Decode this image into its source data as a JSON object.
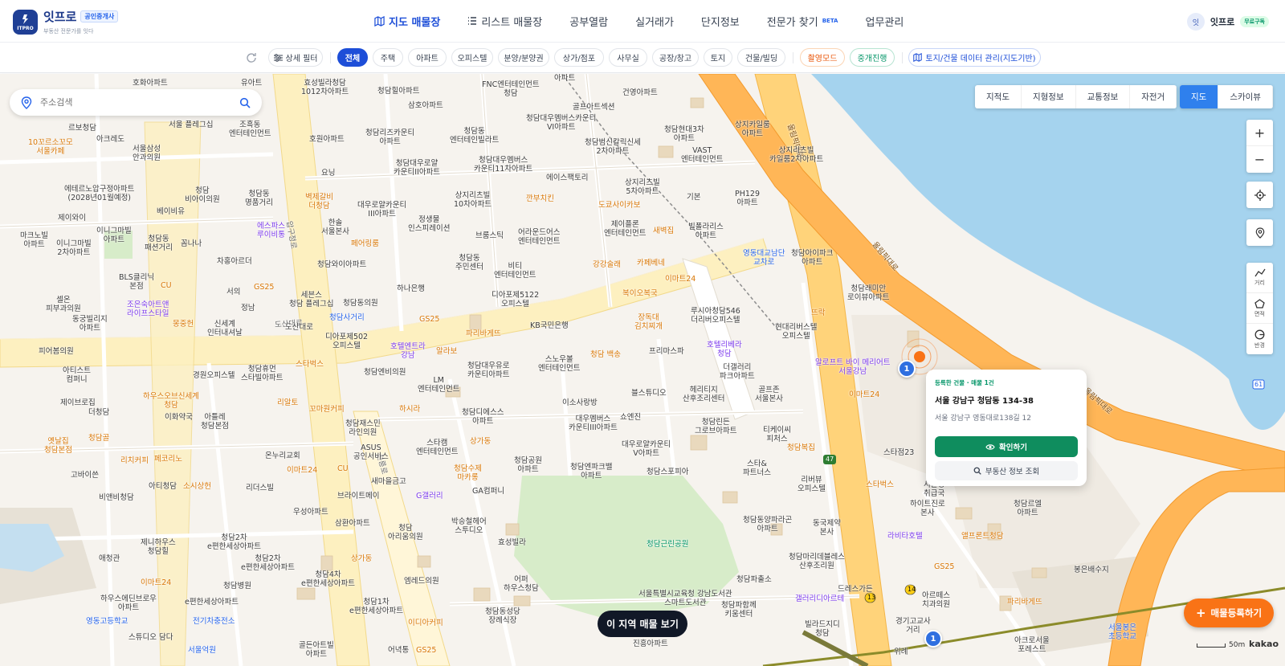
{
  "brand": {
    "name": "잇프로",
    "badge": "공인중개사",
    "subtitle": "부동산 전문가를 잇다",
    "logo_text": "ITPRO"
  },
  "nav": {
    "items": [
      {
        "label": "지도 매물장",
        "icon": "map-icon",
        "active": true
      },
      {
        "label": "리스트 매물장",
        "icon": "list-icon",
        "active": false
      },
      {
        "label": "공부열람",
        "active": false
      },
      {
        "label": "실거래가",
        "active": false
      },
      {
        "label": "단지정보",
        "active": false
      },
      {
        "label": "전문가 찾기",
        "badge": "BETA",
        "active": false
      },
      {
        "label": "업무관리",
        "active": false
      }
    ]
  },
  "user": {
    "avatar": "잇",
    "name": "잇프로",
    "plan": "무료구독"
  },
  "filters": {
    "detail": "상세 필터",
    "chips": [
      "전체",
      "주택",
      "아파트",
      "오피스텔",
      "분양/분양권",
      "상가/점포",
      "사무실",
      "공장/창고",
      "토지",
      "건물/빌딩"
    ],
    "mode": "촬영모드",
    "brokerage": "중개진행",
    "land": "토지/건물 데이터 관리(지도기반)"
  },
  "search": {
    "placeholder": "주소검색"
  },
  "map_types": [
    "지적도",
    "지형정보",
    "교통정보",
    "자전거"
  ],
  "view_types": [
    "지도",
    "스카이뷰"
  ],
  "controls": {
    "zoom_in": "+",
    "zoom_out": "−",
    "distance": "거리",
    "area": "면적",
    "radius": "반경"
  },
  "popup": {
    "tag": "등록한 건물 · 매물 1건",
    "title": "서울 강남구 청담동 134-38",
    "address": "서울 강남구 영동대로138길 12",
    "confirm": "확인하기",
    "lookup": "부동산 정보 조회"
  },
  "clusters": [
    "1",
    "1"
  ],
  "view_area_button": "이 지역 매물 보기",
  "register_button": "매물등록하기",
  "scale": "50m",
  "attribution": "kakao",
  "roads": {
    "olympic": "올림픽대로",
    "dosandaero": "도산대로",
    "apgujeong": "압구정로",
    "seonreung": "선릉로",
    "route13": "13",
    "route14": "14",
    "route47": "47",
    "route61": "61"
  },
  "pois": [
    [
      "유아트",
      300,
      6,
      ""
    ],
    [
      "효성빌라청담\n1012차아파트",
      375,
      6,
      ""
    ],
    [
      "청담힐아파트",
      470,
      16,
      ""
    ],
    [
      "FNC엔터테인먼트\n청담",
      600,
      8,
      ""
    ],
    [
      "아파트",
      690,
      0,
      ""
    ],
    [
      "건영아파트",
      775,
      18,
      ""
    ],
    [
      "호화아파트",
      165,
      6,
      ""
    ],
    [
      "삼호아파트",
      508,
      34,
      ""
    ],
    [
      "골프아트섹션",
      713,
      36,
      ""
    ],
    [
      "청담대우멤버스카운티\nVI아파트",
      655,
      50,
      ""
    ],
    [
      "청담현대3차\n아파트",
      827,
      64,
      ""
    ],
    [
      "상지카일룸\n아파트",
      915,
      58,
      ""
    ],
    [
      "르보청담",
      85,
      62,
      ""
    ],
    [
      "아크레도",
      120,
      76,
      ""
    ],
    [
      "서울 플레그십",
      210,
      58,
      ""
    ],
    [
      "조흑동\n엔터테인먼트",
      285,
      58,
      ""
    ],
    [
      "청담리즈카운티\n아파트",
      455,
      68,
      ""
    ],
    [
      "청담동\n엔터테인빌라트",
      560,
      66,
      ""
    ],
    [
      "청담범신칼릭신세\n2차아파트",
      728,
      80,
      ""
    ],
    [
      "10꼬르소꼬모\n서울카페",
      35,
      80,
      "o"
    ],
    [
      "서울삼성\n안과의원",
      165,
      88,
      ""
    ],
    [
      "호원아파트",
      385,
      76,
      ""
    ],
    [
      "VAST\n엔터테인먼트",
      848,
      90,
      ""
    ],
    [
      "상지리츠빌\n카일룸2차아파트",
      958,
      90,
      ""
    ],
    [
      "청담대우로얄\n카운티II아파트",
      490,
      106,
      ""
    ],
    [
      "청담대우멤버스\n카운티11차아파트",
      590,
      102,
      ""
    ],
    [
      "에이스팩토리",
      680,
      124,
      ""
    ],
    [
      "상지리츠빌\n5차아파트",
      778,
      130,
      ""
    ],
    [
      "에테르노압구정아파트\n(2028년01월예정)",
      80,
      138,
      ""
    ],
    [
      "청담\n비아이의원",
      230,
      140,
      ""
    ],
    [
      "요닝",
      400,
      118,
      ""
    ],
    [
      "청담동\n명품거리",
      305,
      144,
      ""
    ],
    [
      "상지리츠빌\n10차아파트",
      565,
      146,
      ""
    ],
    [
      "기본",
      855,
      148,
      ""
    ],
    [
      "PH129\n아파트",
      915,
      144,
      ""
    ],
    [
      "벽제갈비\n더청담",
      380,
      148,
      "o"
    ],
    [
      "대우로얄카운티\nIII아파트",
      445,
      158,
      ""
    ],
    [
      "깐부치킨",
      655,
      150,
      "o"
    ],
    [
      "도쿄사이카보",
      745,
      158,
      "o"
    ],
    [
      "베이비유",
      195,
      166,
      ""
    ],
    [
      "제이와이",
      72,
      174,
      ""
    ],
    [
      "에스파스\n루이비통",
      320,
      184,
      "p"
    ],
    [
      "한솔\n서울본사",
      400,
      180,
      ""
    ],
    [
      "정생물\n인스피레이션",
      508,
      176,
      ""
    ],
    [
      "제이플론\n엔터테인먼트",
      752,
      182,
      ""
    ],
    [
      "새벽집",
      813,
      190,
      "o"
    ],
    [
      "빌폴라리스\n아파트",
      857,
      185,
      ""
    ],
    [
      "마크노빌\n아파트",
      25,
      196,
      ""
    ],
    [
      "이니그마빌\n아파트",
      120,
      190,
      ""
    ],
    [
      "청담동\n패션거리",
      180,
      200,
      ""
    ],
    [
      "브룸스틱",
      592,
      196,
      ""
    ],
    [
      "어라운드어스\n엔터테인먼트",
      645,
      192,
      ""
    ],
    [
      "꼼나나",
      225,
      206,
      ""
    ],
    [
      "페어링룸",
      437,
      206,
      "o"
    ],
    [
      "이니그마빌\n2차아파트",
      70,
      206,
      ""
    ],
    [
      "청담와이아파트",
      395,
      232,
      ""
    ],
    [
      "차홍아르더",
      270,
      228,
      ""
    ],
    [
      "청담동\n주민센터",
      567,
      224,
      ""
    ],
    [
      "비티\n엔터테인먼트",
      615,
      234,
      ""
    ],
    [
      "강강술래",
      738,
      232,
      "o"
    ],
    [
      "카페베네",
      793,
      230,
      "o"
    ],
    [
      "영동대교남단\n교차로",
      925,
      218,
      "b"
    ],
    [
      "청담아이파크\n아파트",
      985,
      218,
      ""
    ],
    [
      "BLS클리닉\n본점",
      148,
      248,
      ""
    ],
    [
      "CU",
      200,
      258,
      "o"
    ],
    [
      "GS25",
      316,
      260,
      "o"
    ],
    [
      "세븐스\n청담 플레그십",
      360,
      270,
      ""
    ],
    [
      "서의",
      282,
      266,
      ""
    ],
    [
      "하나은행",
      494,
      262,
      ""
    ],
    [
      "이마트24",
      828,
      250,
      "o"
    ],
    [
      "청담래미안\n로이뷰아파트",
      1055,
      262,
      ""
    ],
    [
      "셀온\n피부과의원",
      57,
      276,
      ""
    ],
    [
      "조은숙아트앤\n라이프스타일",
      158,
      282,
      "p"
    ],
    [
      "정남",
      300,
      286,
      ""
    ],
    [
      "청담동의원",
      427,
      280,
      ""
    ],
    [
      "디아포제5122\n오피스텔",
      612,
      270,
      ""
    ],
    [
      "복이오복국",
      775,
      268,
      "o"
    ],
    [
      "뜨락",
      1010,
      292,
      "o"
    ],
    [
      "동궁빌리지\n아파트",
      90,
      300,
      ""
    ],
    [
      "청담사거리",
      410,
      298,
      "b"
    ],
    [
      "신세계\n인터내셔날",
      258,
      306,
      ""
    ],
    [
      "몽중헌",
      215,
      306,
      "o"
    ],
    [
      "루시아청담546\n더리버오피스텔",
      860,
      290,
      ""
    ],
    [
      "현대리버스텔\n오피스텔",
      965,
      310,
      ""
    ],
    [
      "도산대로",
      355,
      310,
      ""
    ],
    [
      "GS25",
      522,
      300,
      "o"
    ],
    [
      "KB국민은행",
      660,
      308,
      ""
    ],
    [
      "장독대\n김치찌개",
      790,
      298,
      "o"
    ],
    [
      "디아포제502\n오피스텔",
      405,
      322,
      ""
    ],
    [
      "파리바게뜨",
      580,
      318,
      "o"
    ],
    [
      "프리마스파",
      808,
      340,
      ""
    ],
    [
      "호텔리베라\n청담",
      880,
      332,
      "p"
    ],
    [
      "피어봄의원",
      48,
      340,
      ""
    ],
    [
      "호텔엔트라\n강남",
      486,
      334,
      "p"
    ],
    [
      "청담대우유로\n카운티아파트",
      582,
      358,
      ""
    ],
    [
      "스노우볼\n엔터테인먼트",
      670,
      350,
      ""
    ],
    [
      "청담 백송",
      735,
      344,
      "o"
    ],
    [
      "알로프트 바이 메리어트\n서울강남",
      1015,
      354,
      "p"
    ],
    [
      "아티스트\n컴퍼니",
      78,
      364,
      ""
    ],
    [
      "알라보",
      543,
      340,
      "o"
    ],
    [
      "스타벅스",
      368,
      356,
      "o"
    ],
    [
      "청담휴먼\n스타빌아파트",
      300,
      362,
      ""
    ],
    [
      "경원오피스텔",
      240,
      370,
      ""
    ],
    [
      "청담엔비의원",
      453,
      366,
      ""
    ],
    [
      "LM\n엔터테인먼트",
      520,
      376,
      ""
    ],
    [
      "더갤러리\n파크아파트",
      896,
      360,
      ""
    ],
    [
      "하우스오브신세계\n청담",
      178,
      396,
      "o"
    ],
    [
      "헤리티지\n산후조리센터",
      850,
      388,
      ""
    ],
    [
      "골프존\n서울본사",
      940,
      388,
      ""
    ],
    [
      "이마트24",
      1057,
      394,
      "o"
    ],
    [
      "블스튜디오",
      786,
      392,
      ""
    ],
    [
      "제이브로집",
      75,
      404,
      ""
    ],
    [
      "이화약국",
      205,
      422,
      ""
    ],
    [
      "리알토",
      345,
      404,
      "o"
    ],
    [
      "꼬마원커피",
      385,
      412,
      "o"
    ],
    [
      "하시라",
      497,
      412,
      "o"
    ],
    [
      "청담디에스스\n아파트",
      575,
      416,
      ""
    ],
    [
      "이소사랑방",
      700,
      404,
      ""
    ],
    [
      "더청담",
      110,
      416,
      ""
    ],
    [
      "아틀레\n청담본점",
      250,
      422,
      ""
    ],
    [
      "청담재스민\n라인의원",
      430,
      430,
      ""
    ],
    [
      "대우멤버스\n카운티III아파트",
      708,
      424,
      ""
    ],
    [
      "쇼엔진",
      772,
      422,
      ""
    ],
    [
      "청담린든\n그로브아파트",
      865,
      428,
      ""
    ],
    [
      "티케이씨\n피처스",
      950,
      438,
      ""
    ],
    [
      "옛날집\n청담본점",
      55,
      452,
      "o"
    ],
    [
      "청담골",
      110,
      448,
      "o"
    ],
    [
      "스타캠\n엔터테인먼트",
      518,
      454,
      ""
    ],
    [
      "상가동",
      585,
      452,
      "o"
    ],
    [
      "대우로얄카운티\nV아파트",
      774,
      456,
      ""
    ],
    [
      "청담복집",
      980,
      460,
      "o"
    ],
    [
      "리치커피",
      150,
      476,
      "o"
    ],
    [
      "페코리노",
      192,
      474,
      "o"
    ],
    [
      "온누리교회",
      330,
      470,
      ""
    ],
    [
      "ASUS\n공인서비스",
      440,
      460,
      ""
    ],
    [
      "청담공원\n아파트",
      640,
      476,
      ""
    ],
    [
      "청담수제\n마카롱",
      565,
      486,
      "o"
    ],
    [
      "청담엔파크밸\n아파트",
      710,
      484,
      ""
    ],
    [
      "청담스포피아",
      805,
      490,
      ""
    ],
    [
      "스타&\n파트너스",
      925,
      480,
      ""
    ],
    [
      "스타점23",
      1100,
      466,
      ""
    ],
    [
      "고바이쓴",
      88,
      494,
      ""
    ],
    [
      "아티청담",
      185,
      508,
      ""
    ],
    [
      "CU",
      420,
      486,
      "o"
    ],
    [
      "이마트24",
      357,
      488,
      "o"
    ],
    [
      "리버뷰\n오피스텔",
      993,
      500,
      ""
    ],
    [
      "스타벅스",
      1078,
      506,
      "o"
    ],
    [
      "서울청\n취급국",
      1150,
      506,
      ""
    ],
    [
      "비앤비청담",
      123,
      522,
      ""
    ],
    [
      "리더스빌",
      306,
      510,
      ""
    ],
    [
      "새마을금고",
      462,
      502,
      ""
    ],
    [
      "소시상헌",
      228,
      508,
      "o"
    ],
    [
      "GA컴퍼니",
      588,
      514,
      ""
    ],
    [
      "G갤러리",
      518,
      520,
      "p"
    ],
    [
      "청담르엘\n아파트",
      1262,
      530,
      ""
    ],
    [
      "브라이트메이",
      420,
      520,
      ""
    ],
    [
      "우성아파트",
      365,
      540,
      ""
    ],
    [
      "하이트진로\n본사",
      1133,
      530,
      ""
    ],
    [
      "삼환아파트",
      417,
      554,
      ""
    ],
    [
      "청담\n아리움의원",
      483,
      560,
      ""
    ],
    [
      "박승철헤어\n스투디오",
      562,
      552,
      ""
    ],
    [
      "청담동양파라곤\n아파트",
      925,
      550,
      ""
    ],
    [
      "동국제약\n본사",
      1012,
      554,
      ""
    ],
    [
      "제니하우스\n청담힐",
      175,
      578,
      ""
    ],
    [
      "청담2차\ne편한세상아파트",
      258,
      572,
      ""
    ],
    [
      "효성빌라",
      620,
      578,
      ""
    ],
    [
      "청담근린공원",
      805,
      580,
      "g"
    ],
    [
      "라비타호텔",
      1105,
      570,
      "p"
    ],
    [
      "앨프론트청담",
      1197,
      570,
      "o"
    ],
    [
      "청담2차\ne편한세상아파트",
      300,
      598,
      ""
    ],
    [
      "상가동",
      437,
      598,
      "o"
    ],
    [
      "애청관",
      123,
      598,
      ""
    ],
    [
      "청담마리데블레스\n산후조리원",
      982,
      596,
      ""
    ],
    [
      "GS25",
      1163,
      608,
      "o"
    ],
    [
      "봉은배수지",
      1337,
      612,
      ""
    ],
    [
      "이마트24",
      175,
      628,
      "o"
    ],
    [
      "청담4차\ne편한세상아파트",
      375,
      618,
      ""
    ],
    [
      "엠레드의원",
      503,
      626,
      ""
    ],
    [
      "어퍼\n하우스청담",
      627,
      624,
      ""
    ],
    [
      "청담파출소",
      917,
      624,
      ""
    ],
    [
      "드레스가든",
      1043,
      636,
      ""
    ],
    [
      "청담병원",
      278,
      632,
      ""
    ],
    [
      "하우스에딘브로우\n아파트",
      125,
      648,
      ""
    ],
    [
      "e편한세상아파트",
      230,
      652,
      ""
    ],
    [
      "청담1차\ne편한세상아파트",
      435,
      652,
      ""
    ],
    [
      "서울특별시교육청 강남도서관\n스마트도서관",
      795,
      642,
      ""
    ],
    [
      "청담파함께\n키움센터",
      898,
      656,
      ""
    ],
    [
      "갤러리디아르테",
      990,
      648,
      "p"
    ],
    [
      "아르떼스\n치과의원",
      1148,
      644,
      ""
    ],
    [
      "영동고등학교",
      107,
      676,
      "b"
    ],
    [
      "전기차충전소",
      240,
      676,
      "b"
    ],
    [
      "청담동성당\n장례식장",
      604,
      664,
      ""
    ],
    [
      "이디아커피",
      508,
      678,
      "o"
    ],
    [
      "빌라드지디\n청담",
      1002,
      680,
      ""
    ],
    [
      "경기고교사\n거리",
      1115,
      676,
      ""
    ],
    [
      "파리바게뜨",
      1254,
      652,
      "o"
    ],
    [
      "스튜디오 담다",
      160,
      696,
      ""
    ],
    [
      "서울억원",
      234,
      712,
      "b"
    ],
    [
      "골든아트빌\n아파트",
      372,
      706,
      ""
    ],
    [
      "진흥아파트",
      788,
      704,
      ""
    ],
    [
      "어녁통",
      483,
      712,
      ""
    ],
    [
      "GS25",
      518,
      712,
      "o"
    ],
    [
      "아크로서울\n포레스트",
      1263,
      700,
      ""
    ],
    [
      "서울봉은\n초등학교",
      1380,
      684,
      "b"
    ],
    [
      "위례",
      1113,
      714,
      ""
    ]
  ]
}
